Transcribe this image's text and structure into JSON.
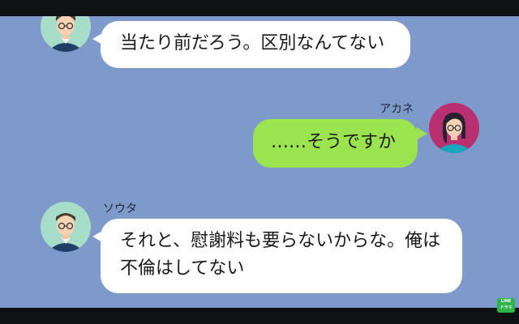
{
  "messages": [
    {
      "sender": "",
      "side": "left",
      "text": "当たり前だろう。区別なんてない"
    },
    {
      "sender": "アカネ",
      "side": "right",
      "text": "……そうですか"
    },
    {
      "sender": "ソウタ",
      "side": "left",
      "lines": [
        "それと、慰謝料も要らないからな。俺は",
        "不倫はしてない"
      ]
    }
  ],
  "logo": {
    "line1": "LINE",
    "line2": "ドラマ"
  },
  "colors": {
    "chat_background": "#7e9acb",
    "incoming_bubble": "#ffffff",
    "outgoing_bubble": "#9ce44f",
    "letterbox": "#0f1114"
  }
}
